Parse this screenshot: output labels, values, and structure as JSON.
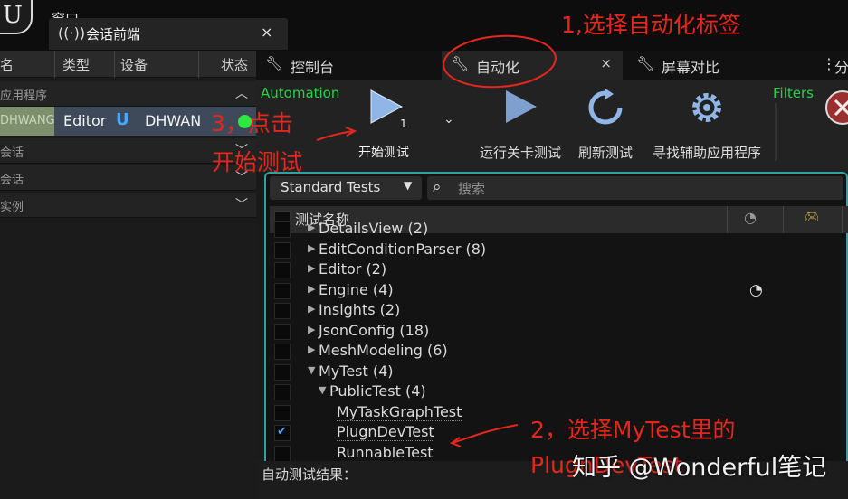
{
  "window": {
    "menu_label": "窗口"
  },
  "session_tab": {
    "title": "会话前端",
    "close": "×"
  },
  "left_panel": {
    "columns": [
      "名",
      "类型",
      "设备",
      "状态"
    ],
    "groups": [
      {
        "label": "应用程序",
        "expanded": true
      },
      {
        "label": "会话",
        "expanded": false
      },
      {
        "label": "会话",
        "expanded": false
      },
      {
        "label": "实例",
        "expanded": false
      }
    ],
    "instance": {
      "name": "DHWANG",
      "type": "Editor",
      "device": "DHWAN",
      "status_color": "#2ee83f"
    }
  },
  "right_tabs": [
    {
      "label": "控制台",
      "icon": "wrench-icon"
    },
    {
      "label": "自动化",
      "icon": "wrench-icon",
      "active": true,
      "close": "×"
    },
    {
      "label": "屏幕对比",
      "icon": "wrench-icon"
    },
    {
      "label": "分",
      "icon": "compare-icon"
    }
  ],
  "toolbar": {
    "automation_label": "Automation",
    "filters_label": "Filters",
    "start_label": "开始测试",
    "start_count": "1",
    "run_level_label": "运行关卡测试",
    "refresh_label": "刷新测试",
    "find_label": "寻找辅助应用程序",
    "errors_label": "错误"
  },
  "test_filter": {
    "preset": "Standard Tests",
    "search_placeholder": "搜索"
  },
  "test_list": {
    "header": "测试名称",
    "rows": [
      {
        "label": "DetailsView (2)",
        "level": 0,
        "expanded": false,
        "checked": false
      },
      {
        "label": "EditConditionParser (8)",
        "level": 0,
        "expanded": false,
        "checked": false
      },
      {
        "label": "Editor (2)",
        "level": 0,
        "expanded": false,
        "checked": false
      },
      {
        "label": "Engine (4)",
        "level": 0,
        "expanded": false,
        "checked": false
      },
      {
        "label": "Insights (2)",
        "level": 0,
        "expanded": false,
        "checked": false
      },
      {
        "label": "JsonConfig (18)",
        "level": 0,
        "expanded": false,
        "checked": false
      },
      {
        "label": "MeshModeling (6)",
        "level": 0,
        "expanded": false,
        "checked": false
      },
      {
        "label": "MyTest (4)",
        "level": 0,
        "expanded": true,
        "checked": false
      },
      {
        "label": "PublicTest (4)",
        "level": 1,
        "expanded": true,
        "checked": false
      },
      {
        "label": "MyTaskGraphTest",
        "level": 2,
        "leaf": true,
        "checked": false
      },
      {
        "label": "PlugnDevTest",
        "level": 2,
        "leaf": true,
        "checked": true
      },
      {
        "label": "RunnableTest",
        "level": 2,
        "leaf": true,
        "checked": false
      }
    ]
  },
  "results_label": "自动测试结果：",
  "annotations": {
    "step1": "1,选择自动化标签",
    "step3_line1": "3，点击",
    "step3_line2": "开始测试",
    "step2_line1": "2，选择MyTest里的",
    "step2_line2": "PlugnDevTest",
    "annotation_color": "#e5261c"
  },
  "watermark": "知乎 @Wonderful笔记"
}
